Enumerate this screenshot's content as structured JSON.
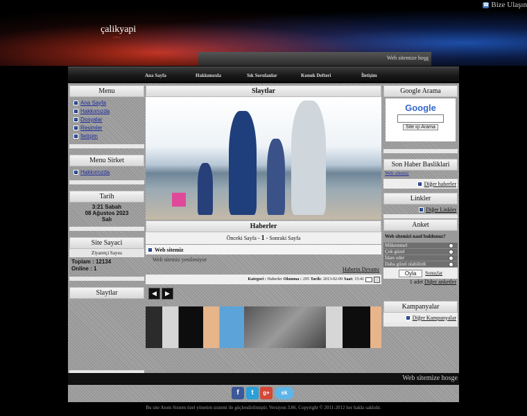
{
  "header": {
    "logo": "çalikyapi",
    "logo_sub": "www",
    "contact": "Bize Ulaşın",
    "marquee": "Web sitemize hoşg"
  },
  "nav": [
    "Ana Sayfa",
    "Hakkımızda",
    "Sık Sorulanlar",
    "Konuk Defteri",
    "İletişim"
  ],
  "left": {
    "menu_title": "Menu",
    "menu_items": [
      "Ana Sayfa",
      "Hakkımızda",
      "Dosyalar",
      "Resimler",
      "İletişim"
    ],
    "menu_sirket_title": "Menu Sirket",
    "menu_sirket_items": [
      "Hakkımızda"
    ],
    "date_title": "Tarih",
    "time": "3:21 Sabah",
    "date": "08 Ağustos 2023",
    "day": "Salı",
    "counter_title": "Site Sayaci",
    "counter_sub": "Ziyaretçi Sayısı",
    "total": "Toplam : 12134",
    "online": "Online : 1",
    "slider_title": "Slaytlar"
  },
  "center": {
    "slider_title": "Slaytlar",
    "news_title": "Haberler",
    "pager_prev": "Önceki Sayfa",
    "pager_current": "1",
    "pager_next": "Sonraki Sayfa",
    "pager_sep": "-",
    "news_item_title": "Web sitemiz",
    "news_item_body": "Web sitemiz yenileniyor",
    "read_more": "Haberin Devamı",
    "meta_category_label": "Kategori :",
    "meta_category": "Haberler",
    "meta_reads_label": "Okunma :",
    "meta_reads": "295",
    "meta_date_label": "Tarih:",
    "meta_date": "2013-02-09",
    "meta_time_label": "Saat:",
    "meta_time": "15:41",
    "prev_arrow": "◀",
    "next_arrow": "▶"
  },
  "right": {
    "google_title": "Google Arama",
    "google_logo": "Google",
    "search_button": "Site içi Arama",
    "news_headlines_title": "Son Haber Basliklari",
    "headline": "Web sitemiz",
    "other_news": "Diğer haberler",
    "links_title": "Linkler",
    "other_links": "Diğer Linkler",
    "poll_title": "Anket",
    "poll_question": "Web sitemizi nasıl buldunuz?",
    "poll_options": [
      "Mükemmel",
      "Çok güzel",
      "İdare eder",
      "Daha güzel olabilirdi"
    ],
    "vote_button": "Oyla",
    "results": "Sonuçlar",
    "poll_count": "1 adet",
    "other_polls": "Diğer anketler",
    "campaigns_title": "Kampanyalar",
    "other_campaigns": "Diğer Kampanyalar"
  },
  "footer": {
    "marquee": "Web sitemize hosge",
    "social": [
      "f",
      "t",
      "g+",
      "sk"
    ],
    "copyright": "Bu site Atom Sistem özel yönetim sistemi ile güçlendirilmiştir. Versiyon 3.86. Copyright © 2011-2012 her hakkı saklıdır."
  }
}
